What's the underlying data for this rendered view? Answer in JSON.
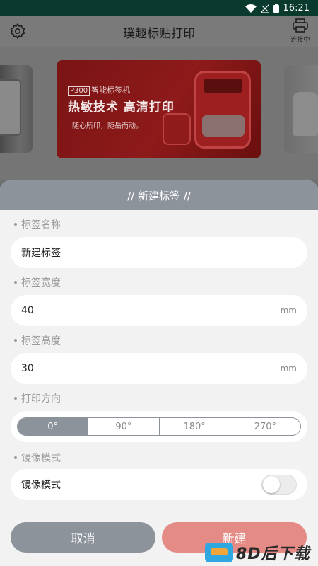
{
  "status_bar": {
    "time": "16:21"
  },
  "header": {
    "title": "璞趣标贴打印",
    "printer_status": "连接中"
  },
  "banner": {
    "model_tag": "P300",
    "model_name": "智能标签机",
    "headline": "热敏技术 高清打印",
    "slogan": "随心所印，随岳而动。"
  },
  "dialog": {
    "title": "// 新建标签 //",
    "name": {
      "label": "标签名称",
      "value": "新建标签"
    },
    "width": {
      "label": "标签宽度",
      "value": "40",
      "unit": "mm"
    },
    "height": {
      "label": "标签高度",
      "value": "30",
      "unit": "mm"
    },
    "direction": {
      "label": "打印方向",
      "options": [
        "0°",
        "90°",
        "180°",
        "270°"
      ],
      "selected": "0°"
    },
    "mirror": {
      "label": "镜像模式",
      "row_label": "镜像模式",
      "enabled": false
    },
    "cancel_label": "取消",
    "create_label": "新建"
  },
  "watermark": {
    "text": "8D后下载"
  },
  "colors": {
    "accent": "#8c939b",
    "create_button": "#e58b86",
    "status_bar": "#0a3a2e"
  }
}
